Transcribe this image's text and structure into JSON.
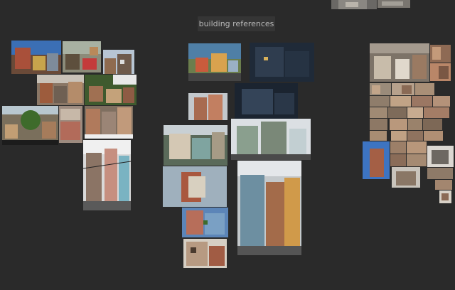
{
  "board": {
    "title": "building references",
    "background": "#2a2a2a"
  }
}
